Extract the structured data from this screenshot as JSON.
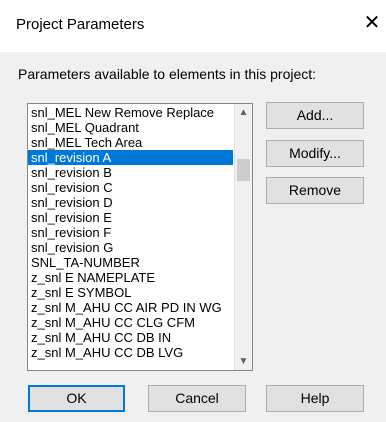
{
  "window": {
    "title": "Project Parameters",
    "close_glyph": "✕"
  },
  "label": "Parameters available to elements in this project:",
  "parameters": {
    "items": [
      "snl_MEL New Remove Replace",
      "snl_MEL Quadrant",
      "snl_MEL Tech Area",
      "snl_revision A",
      "snl_revision B",
      "snl_revision C",
      "snl_revision D",
      "snl_revision E",
      "snl_revision F",
      "snl_revision G",
      "SNL_TA-NUMBER",
      "z_snl E NAMEPLATE",
      "z_snl E SYMBOL",
      "z_snl M_AHU CC AIR PD IN WG",
      "z_snl M_AHU CC CLG CFM",
      "z_snl M_AHU CC DB IN",
      "z_snl M_AHU CC DB LVG"
    ],
    "selected": "snl_revision A",
    "scroll_up_glyph": "▲",
    "scroll_down_glyph": "▼"
  },
  "side_buttons": {
    "add": "Add...",
    "modify": "Modify...",
    "remove": "Remove"
  },
  "footer_buttons": {
    "ok": "OK",
    "cancel": "Cancel",
    "help": "Help"
  },
  "colors": {
    "selection": "#0078d7",
    "dialog_bg": "#f0f0f0",
    "button_bg": "#e1e1e1"
  }
}
